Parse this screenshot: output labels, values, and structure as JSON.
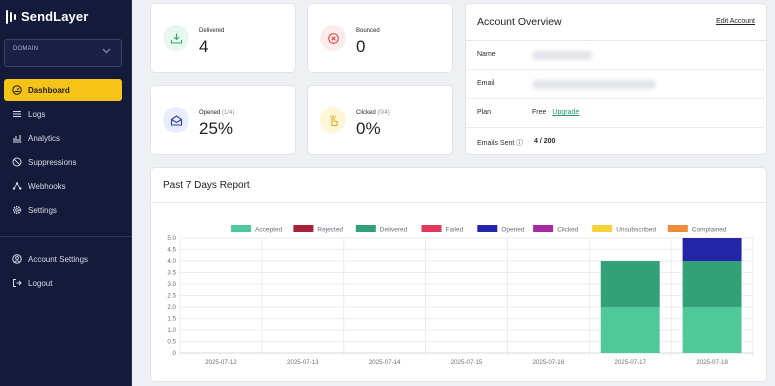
{
  "sidebar": {
    "logo": "SendLayer",
    "domain_label": "DOMAIN",
    "nav": [
      {
        "label": "Dashboard",
        "icon": "dashboard-icon"
      },
      {
        "label": "Logs",
        "icon": "list-icon"
      },
      {
        "label": "Analytics",
        "icon": "chart-icon"
      },
      {
        "label": "Suppressions",
        "icon": "block-icon"
      },
      {
        "label": "Webhooks",
        "icon": "webhook-icon"
      },
      {
        "label": "Settings",
        "icon": "gear-icon"
      }
    ],
    "bottom_nav": [
      {
        "label": "Account Settings",
        "icon": "user-circle-icon"
      },
      {
        "label": "Logout",
        "icon": "logout-icon"
      }
    ]
  },
  "stats": {
    "delivered": {
      "label": "Delivered",
      "value": "4"
    },
    "bounced": {
      "label": "Bounced",
      "value": "0"
    },
    "opened": {
      "label": "Opened",
      "sub": "(1/4)",
      "value": "25%"
    },
    "clicked": {
      "label": "Clicked",
      "sub": "(0/4)",
      "value": "0%"
    }
  },
  "account": {
    "title": "Account Overview",
    "edit_label": "Edit Account",
    "name_label": "Name",
    "email_label": "Email",
    "plan_label": "Plan",
    "plan_value": "Free",
    "upgrade_label": "Upgrade",
    "emails_sent_label": "Emails Sent ⓘ",
    "emails_sent_value": "4 / 200"
  },
  "report": {
    "title": "Past 7 Days Report"
  },
  "colors": {
    "sidebar_bg": "#141a3a",
    "accent": "#f6c417",
    "accepted": "#4fc99a",
    "rejected": "#a52237",
    "delivered": "#33a078",
    "failed": "#e0385b",
    "opened": "#2324a8",
    "clicked": "#a72aa0",
    "unsubscribed": "#f7d23b",
    "complained": "#ef8c3c"
  },
  "chart_data": {
    "type": "bar",
    "stacked": true,
    "title": "",
    "categories": [
      "2025-07-12",
      "2025-07-13",
      "2025-07-14",
      "2025-07-15",
      "2025-07-16",
      "2025-07-17",
      "2025-07-18"
    ],
    "ylim": [
      0,
      5
    ],
    "yticks": [
      "0",
      "0.5",
      "1.0",
      "1.5",
      "2.0",
      "2.5",
      "3.0",
      "3.5",
      "4.0",
      "4.5",
      "5.0"
    ],
    "grid": true,
    "legend_position": "top",
    "series": [
      {
        "name": "Accepted",
        "color": "#4fc99a",
        "values": [
          0,
          0,
          0,
          0,
          0,
          2,
          2
        ]
      },
      {
        "name": "Rejected",
        "color": "#a52237",
        "values": [
          0,
          0,
          0,
          0,
          0,
          0,
          0
        ]
      },
      {
        "name": "Delivered",
        "color": "#33a078",
        "values": [
          0,
          0,
          0,
          0,
          0,
          2,
          2
        ]
      },
      {
        "name": "Failed",
        "color": "#e0385b",
        "values": [
          0,
          0,
          0,
          0,
          0,
          0,
          0
        ]
      },
      {
        "name": "Opened",
        "color": "#2324a8",
        "values": [
          0,
          0,
          0,
          0,
          0,
          0,
          1
        ]
      },
      {
        "name": "Clicked",
        "color": "#a72aa0",
        "values": [
          0,
          0,
          0,
          0,
          0,
          0,
          0
        ]
      },
      {
        "name": "Unsubscribed",
        "color": "#f7d23b",
        "values": [
          0,
          0,
          0,
          0,
          0,
          0,
          0
        ]
      },
      {
        "name": "Complained",
        "color": "#ef8c3c",
        "values": [
          0,
          0,
          0,
          0,
          0,
          0,
          0
        ]
      }
    ]
  }
}
